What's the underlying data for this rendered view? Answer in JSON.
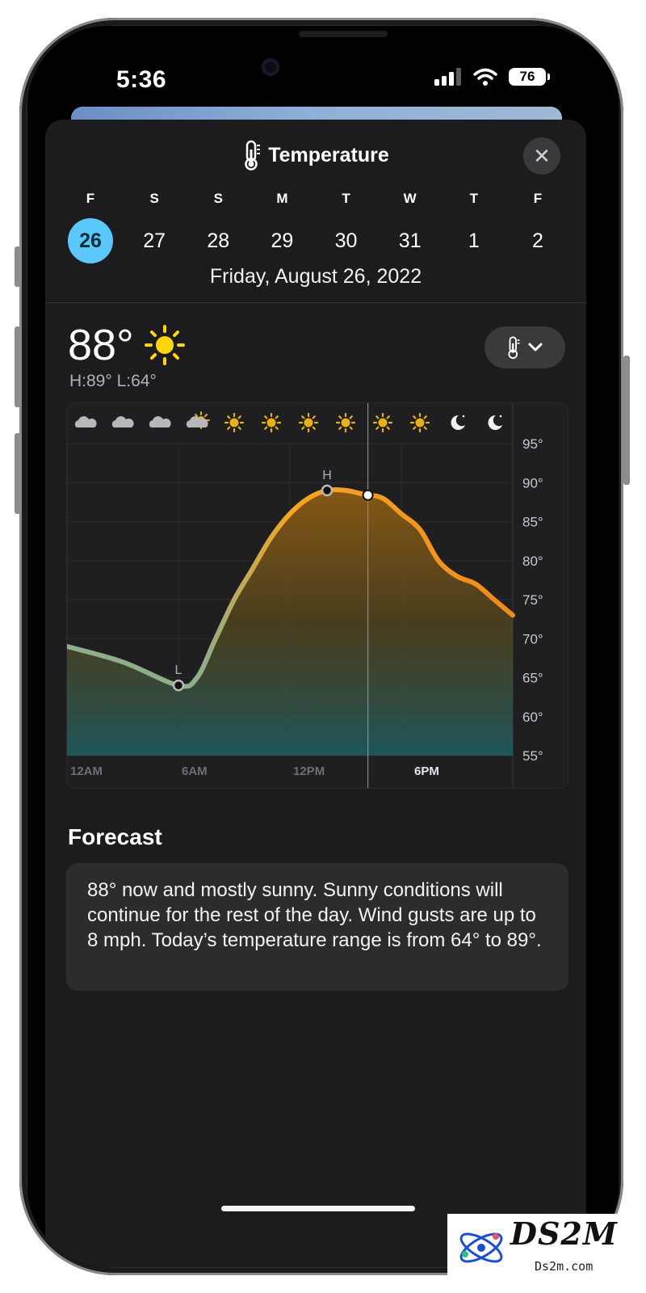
{
  "status": {
    "time": "5:36",
    "battery": "76"
  },
  "header": {
    "title": "Temperature",
    "close_label": "✕"
  },
  "days": [
    {
      "letter": "F",
      "num": "26",
      "selected": true
    },
    {
      "letter": "S",
      "num": "27"
    },
    {
      "letter": "S",
      "num": "28"
    },
    {
      "letter": "M",
      "num": "29"
    },
    {
      "letter": "T",
      "num": "30"
    },
    {
      "letter": "W",
      "num": "31"
    },
    {
      "letter": "T",
      "num": "1"
    },
    {
      "letter": "F",
      "num": "2"
    }
  ],
  "date_text": "Friday, August 26, 2022",
  "current": {
    "temp": "88°",
    "hilo": "H:89° L:64°",
    "condition_icon": "sun-icon"
  },
  "chart_data": {
    "type": "area",
    "x_ticks": [
      "12AM",
      "6AM",
      "12PM",
      "6PM"
    ],
    "y_ticks": [
      "95°",
      "90°",
      "85°",
      "80°",
      "75°",
      "70°",
      "65°",
      "60°",
      "55°"
    ],
    "ylim": [
      55,
      95
    ],
    "xlim": [
      0,
      24
    ],
    "x": [
      0,
      3,
      6,
      7,
      8,
      9,
      10,
      11,
      12,
      13,
      14,
      15,
      16,
      17,
      18,
      19,
      20,
      21,
      22,
      23,
      24
    ],
    "values": [
      69,
      67,
      64,
      65,
      70,
      75,
      79,
      83,
      86,
      88,
      89,
      89,
      88.5,
      88,
      86,
      84,
      80,
      78,
      77,
      75,
      73
    ],
    "low_marker": {
      "x": 6,
      "y": 64,
      "label": "L"
    },
    "high_marker": {
      "x": 14,
      "y": 89,
      "label": "H"
    },
    "now_x": 16.2,
    "hour_icons": [
      "cloud-icon",
      "cloud-icon",
      "cloud-icon",
      "partly-sunny-icon",
      "sun-icon",
      "sun-icon",
      "sun-icon",
      "sun-icon",
      "sun-icon",
      "sun-icon",
      "moon-icon",
      "moon-icon"
    ],
    "colors": {
      "cool": "#8fae8a",
      "warm": "#f5a623",
      "hot": "#f08a1c",
      "fill_bottom": "#1f5e63"
    }
  },
  "forecast": {
    "heading": "Forecast",
    "text": "88° now and mostly sunny. Sunny conditions will continue for the rest of the day. Wind gusts are up to 8 mph. Today’s temperature range is from 64° to 89°."
  },
  "watermark": {
    "brand": "DS2M",
    "domain": "Ds2m.com"
  }
}
